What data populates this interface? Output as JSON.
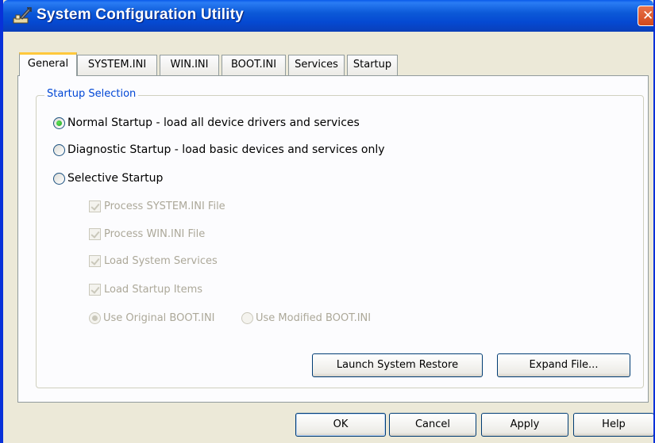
{
  "window": {
    "title": "System Configuration Utility",
    "close_glyph": "✕"
  },
  "tabs": [
    {
      "label": "General",
      "active": true
    },
    {
      "label": "SYSTEM.INI",
      "active": false
    },
    {
      "label": "WIN.INI",
      "active": false
    },
    {
      "label": "BOOT.INI",
      "active": false
    },
    {
      "label": "Services",
      "active": false
    },
    {
      "label": "Startup",
      "active": false
    }
  ],
  "startup_selection": {
    "group_label": "Startup Selection",
    "options": [
      {
        "label": "Normal Startup - load all device drivers and services",
        "selected": true
      },
      {
        "label": "Diagnostic Startup - load basic devices and services only",
        "selected": false
      },
      {
        "label": "Selective Startup",
        "selected": false
      }
    ],
    "selective_items": [
      {
        "label": "Process SYSTEM.INI File",
        "checked": true,
        "enabled": false
      },
      {
        "label": "Process WIN.INI File",
        "checked": true,
        "enabled": false
      },
      {
        "label": "Load System Services",
        "checked": true,
        "enabled": false
      },
      {
        "label": "Load Startup Items",
        "checked": true,
        "enabled": false
      }
    ],
    "boot_ini_options": [
      {
        "label": "Use Original BOOT.INI",
        "selected": true,
        "enabled": false
      },
      {
        "label": "Use Modified BOOT.INI",
        "selected": false,
        "enabled": false
      }
    ]
  },
  "panel_buttons": {
    "launch_restore": "Launch System Restore",
    "expand_file": "Expand File..."
  },
  "dialog_buttons": {
    "ok": "OK",
    "cancel": "Cancel",
    "apply": "Apply",
    "help": "Help"
  },
  "colors": {
    "titlebar": "#0549d2",
    "accent_tab": "#ffc83c",
    "group_label": "#0046d5",
    "window_bg": "#ece9d8"
  }
}
